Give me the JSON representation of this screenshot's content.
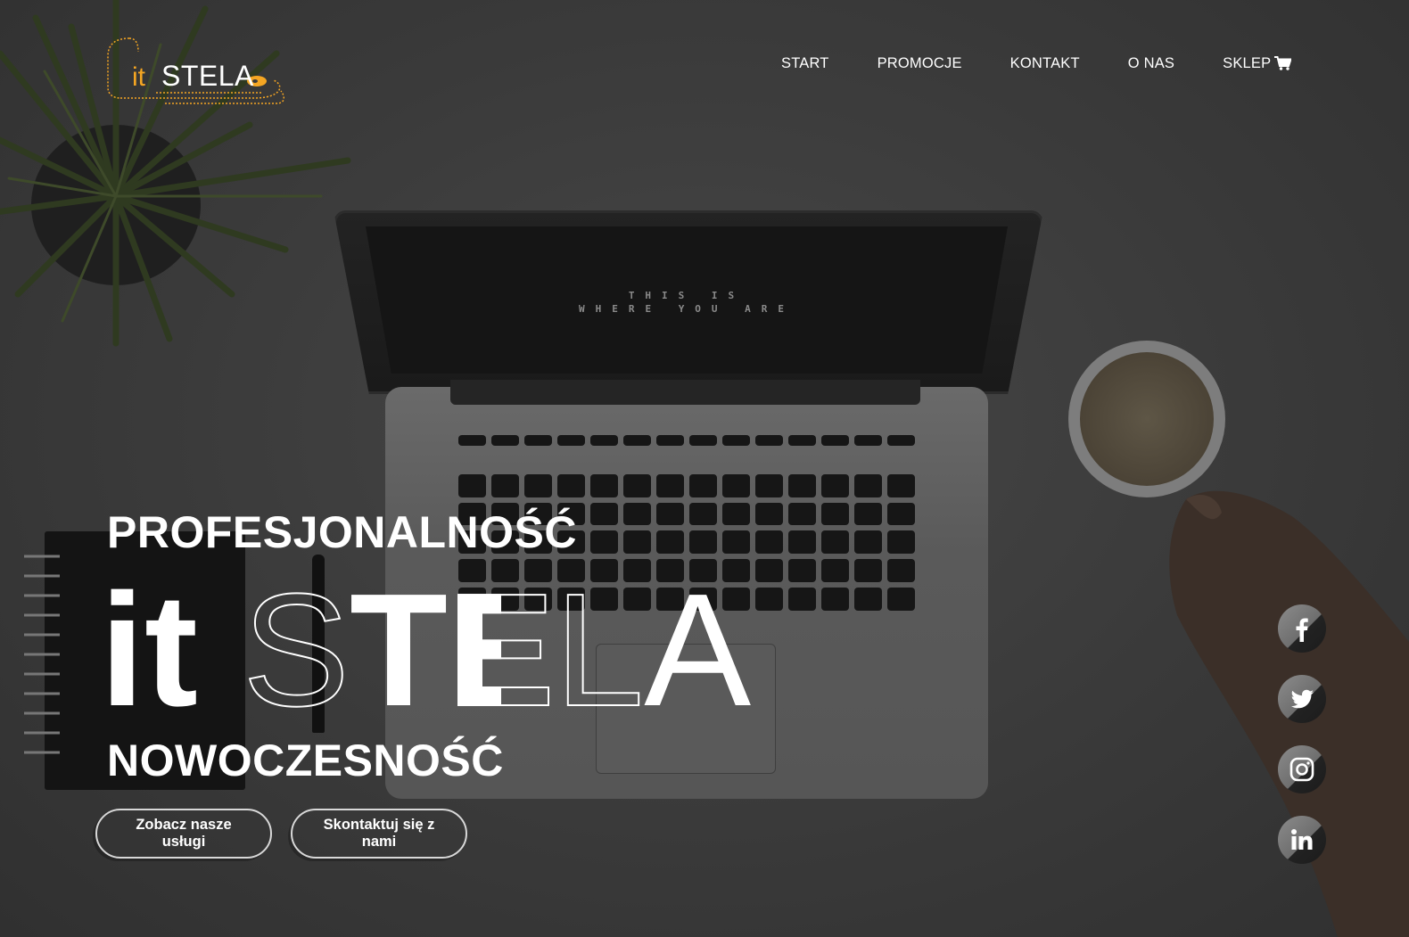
{
  "logo": {
    "it": "it",
    "stela": "STELA"
  },
  "nav": {
    "items": [
      {
        "label": "START"
      },
      {
        "label": "PROMOCJE"
      },
      {
        "label": "KONTAKT"
      },
      {
        "label": "O NAS"
      },
      {
        "label": "SKLEP",
        "icon": "cart-icon"
      }
    ]
  },
  "hero": {
    "tagline_top": "PROFESJONALNOŚĆ",
    "brand_it": "it",
    "brand_s": "S",
    "brand_t": "T",
    "brand_e": "E",
    "brand_l": "L",
    "brand_a": "A",
    "tagline_bottom": "NOWOCZESNOŚĆ",
    "screen_line1": "THIS IS",
    "screen_line2": "WHERE YOU ARE"
  },
  "actions": {
    "services_label": "Zobacz nasze usługi",
    "contact_label": "Skontaktuj się z nami"
  },
  "social": {
    "items": [
      "facebook-icon",
      "twitter-icon",
      "instagram-icon",
      "linkedin-icon"
    ]
  },
  "colors": {
    "accent": "#f5a623",
    "background": "#3a3a3a",
    "text": "#ffffff"
  }
}
